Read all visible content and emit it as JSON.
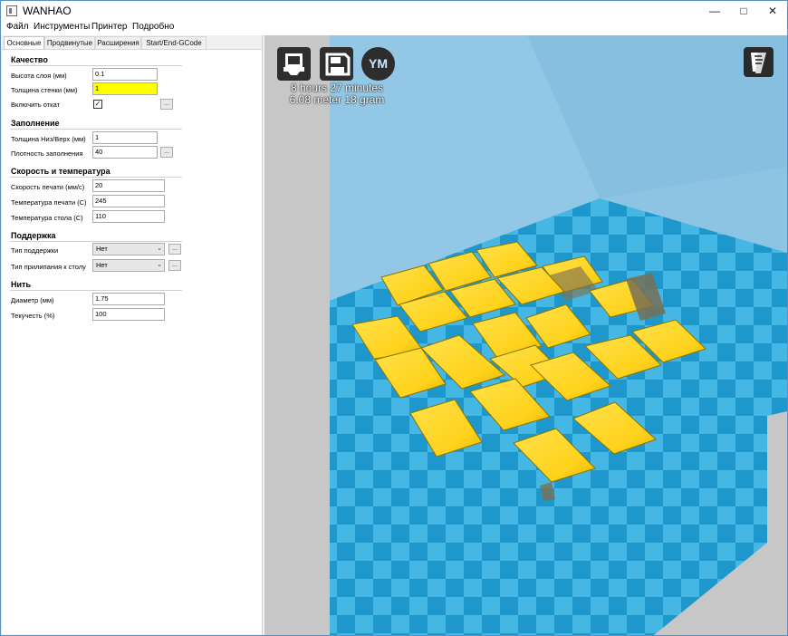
{
  "window": {
    "title": "WANHAO",
    "controls": [
      "—",
      "□",
      "✕"
    ]
  },
  "menu": [
    "Файл",
    "Инструменты",
    "Принтер",
    "Подробно"
  ],
  "tabs": [
    "Основные",
    "Продвинутые",
    "Расширения",
    "Start/End-GCode"
  ],
  "sections": {
    "quality": {
      "title": "Качество",
      "layer_height_label": "Высота слоя (мм)",
      "layer_height_value": "0.1",
      "wall_thickness_label": "Толщина стенки (мм)",
      "wall_thickness_value": "1",
      "retraction_label": "Включить откат",
      "retraction_checked": "✓",
      "dots": "..."
    },
    "fill": {
      "title": "Заполнение",
      "bottom_top_label": "Толщина Низ/Верх (мм)",
      "bottom_top_value": "1",
      "density_label": "Плотность заполнения",
      "density_value": "40",
      "dots": "..."
    },
    "speed": {
      "title": "Скорость и температура",
      "print_speed_label": "Скорость печати (мм/с)",
      "print_speed_value": "20",
      "print_temp_label": "Температура печати (C)",
      "print_temp_value": "245",
      "bed_temp_label": "Температура стола (C)",
      "bed_temp_value": "110"
    },
    "support": {
      "title": "Поддержка",
      "support_type_label": "Тип поддержки",
      "support_type_value": "Нет",
      "adhesion_label": "Тип прилипания к столу",
      "adhesion_value": "Нет",
      "dots": "..."
    },
    "filament": {
      "title": "Нить",
      "diameter_label": "Диаметр (мм)",
      "diameter_value": "1.75",
      "flow_label": "Текучесть (%)",
      "flow_value": "100"
    }
  },
  "viewport": {
    "print_time": "8 hours 27 minutes",
    "print_material": "6.08 meter 18 gram",
    "buttons": {
      "load": "load-icon",
      "save": "save-icon",
      "ym": "YM",
      "view": "view-mode-icon"
    },
    "colors": {
      "background": "#8dc3e3",
      "bed_tile_light": "#45b7e5",
      "bed_tile_dark": "#1d97cc",
      "side_walls": "#c7c7c7",
      "parts": "#ffd21c"
    }
  }
}
